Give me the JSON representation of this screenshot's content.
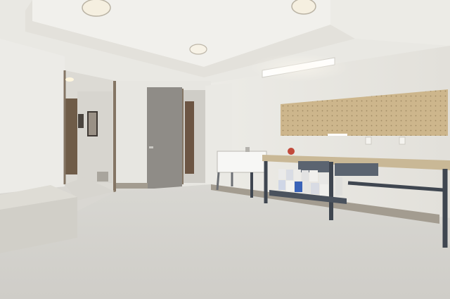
{
  "scene": {
    "kind": "photograph",
    "subject": "basement-workshop-room",
    "colors": {
      "ceiling": "#ecebe7",
      "wall": "#e6e4df",
      "floor": "#d4d3cf",
      "door": "#8f8c87",
      "pegboard": "#cdb68c",
      "bench_top": "#c9b896",
      "bench_frame": "#3f4650",
      "baseboard": "#9d968b",
      "light_glow": "#fff7e6"
    }
  }
}
